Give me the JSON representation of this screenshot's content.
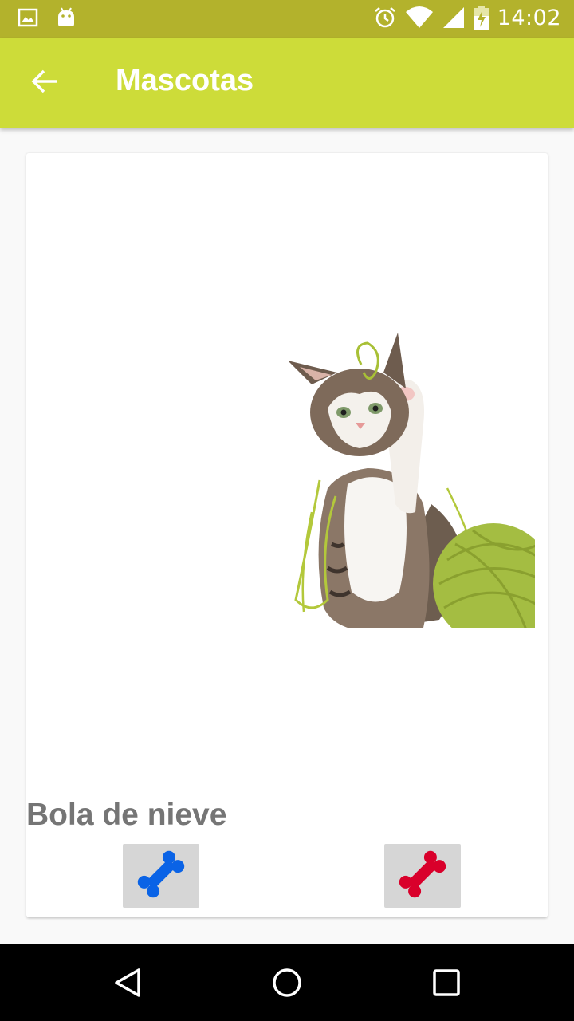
{
  "status_bar": {
    "time": "14:02",
    "icons": [
      "image-icon",
      "android-icon",
      "alarm-icon",
      "wifi-icon",
      "signal-icon",
      "battery-charging-icon"
    ]
  },
  "app_bar": {
    "title": "Mascotas",
    "back_icon": "arrow-back-icon"
  },
  "card": {
    "image": "kitten-with-yarn-ball",
    "pet_name": "Bola de nieve",
    "buttons": [
      {
        "icon": "bone-icon",
        "color": "#0a63e6"
      },
      {
        "icon": "bone-icon",
        "color": "#d9002b"
      }
    ]
  },
  "nav_bar": {
    "icons": [
      "nav-back-icon",
      "nav-home-icon",
      "nav-recents-icon"
    ]
  },
  "colors": {
    "status_bar": "#b3b22c",
    "app_bar": "#cddc39",
    "title_text": "#ffffff",
    "pet_name_text": "#757575"
  }
}
